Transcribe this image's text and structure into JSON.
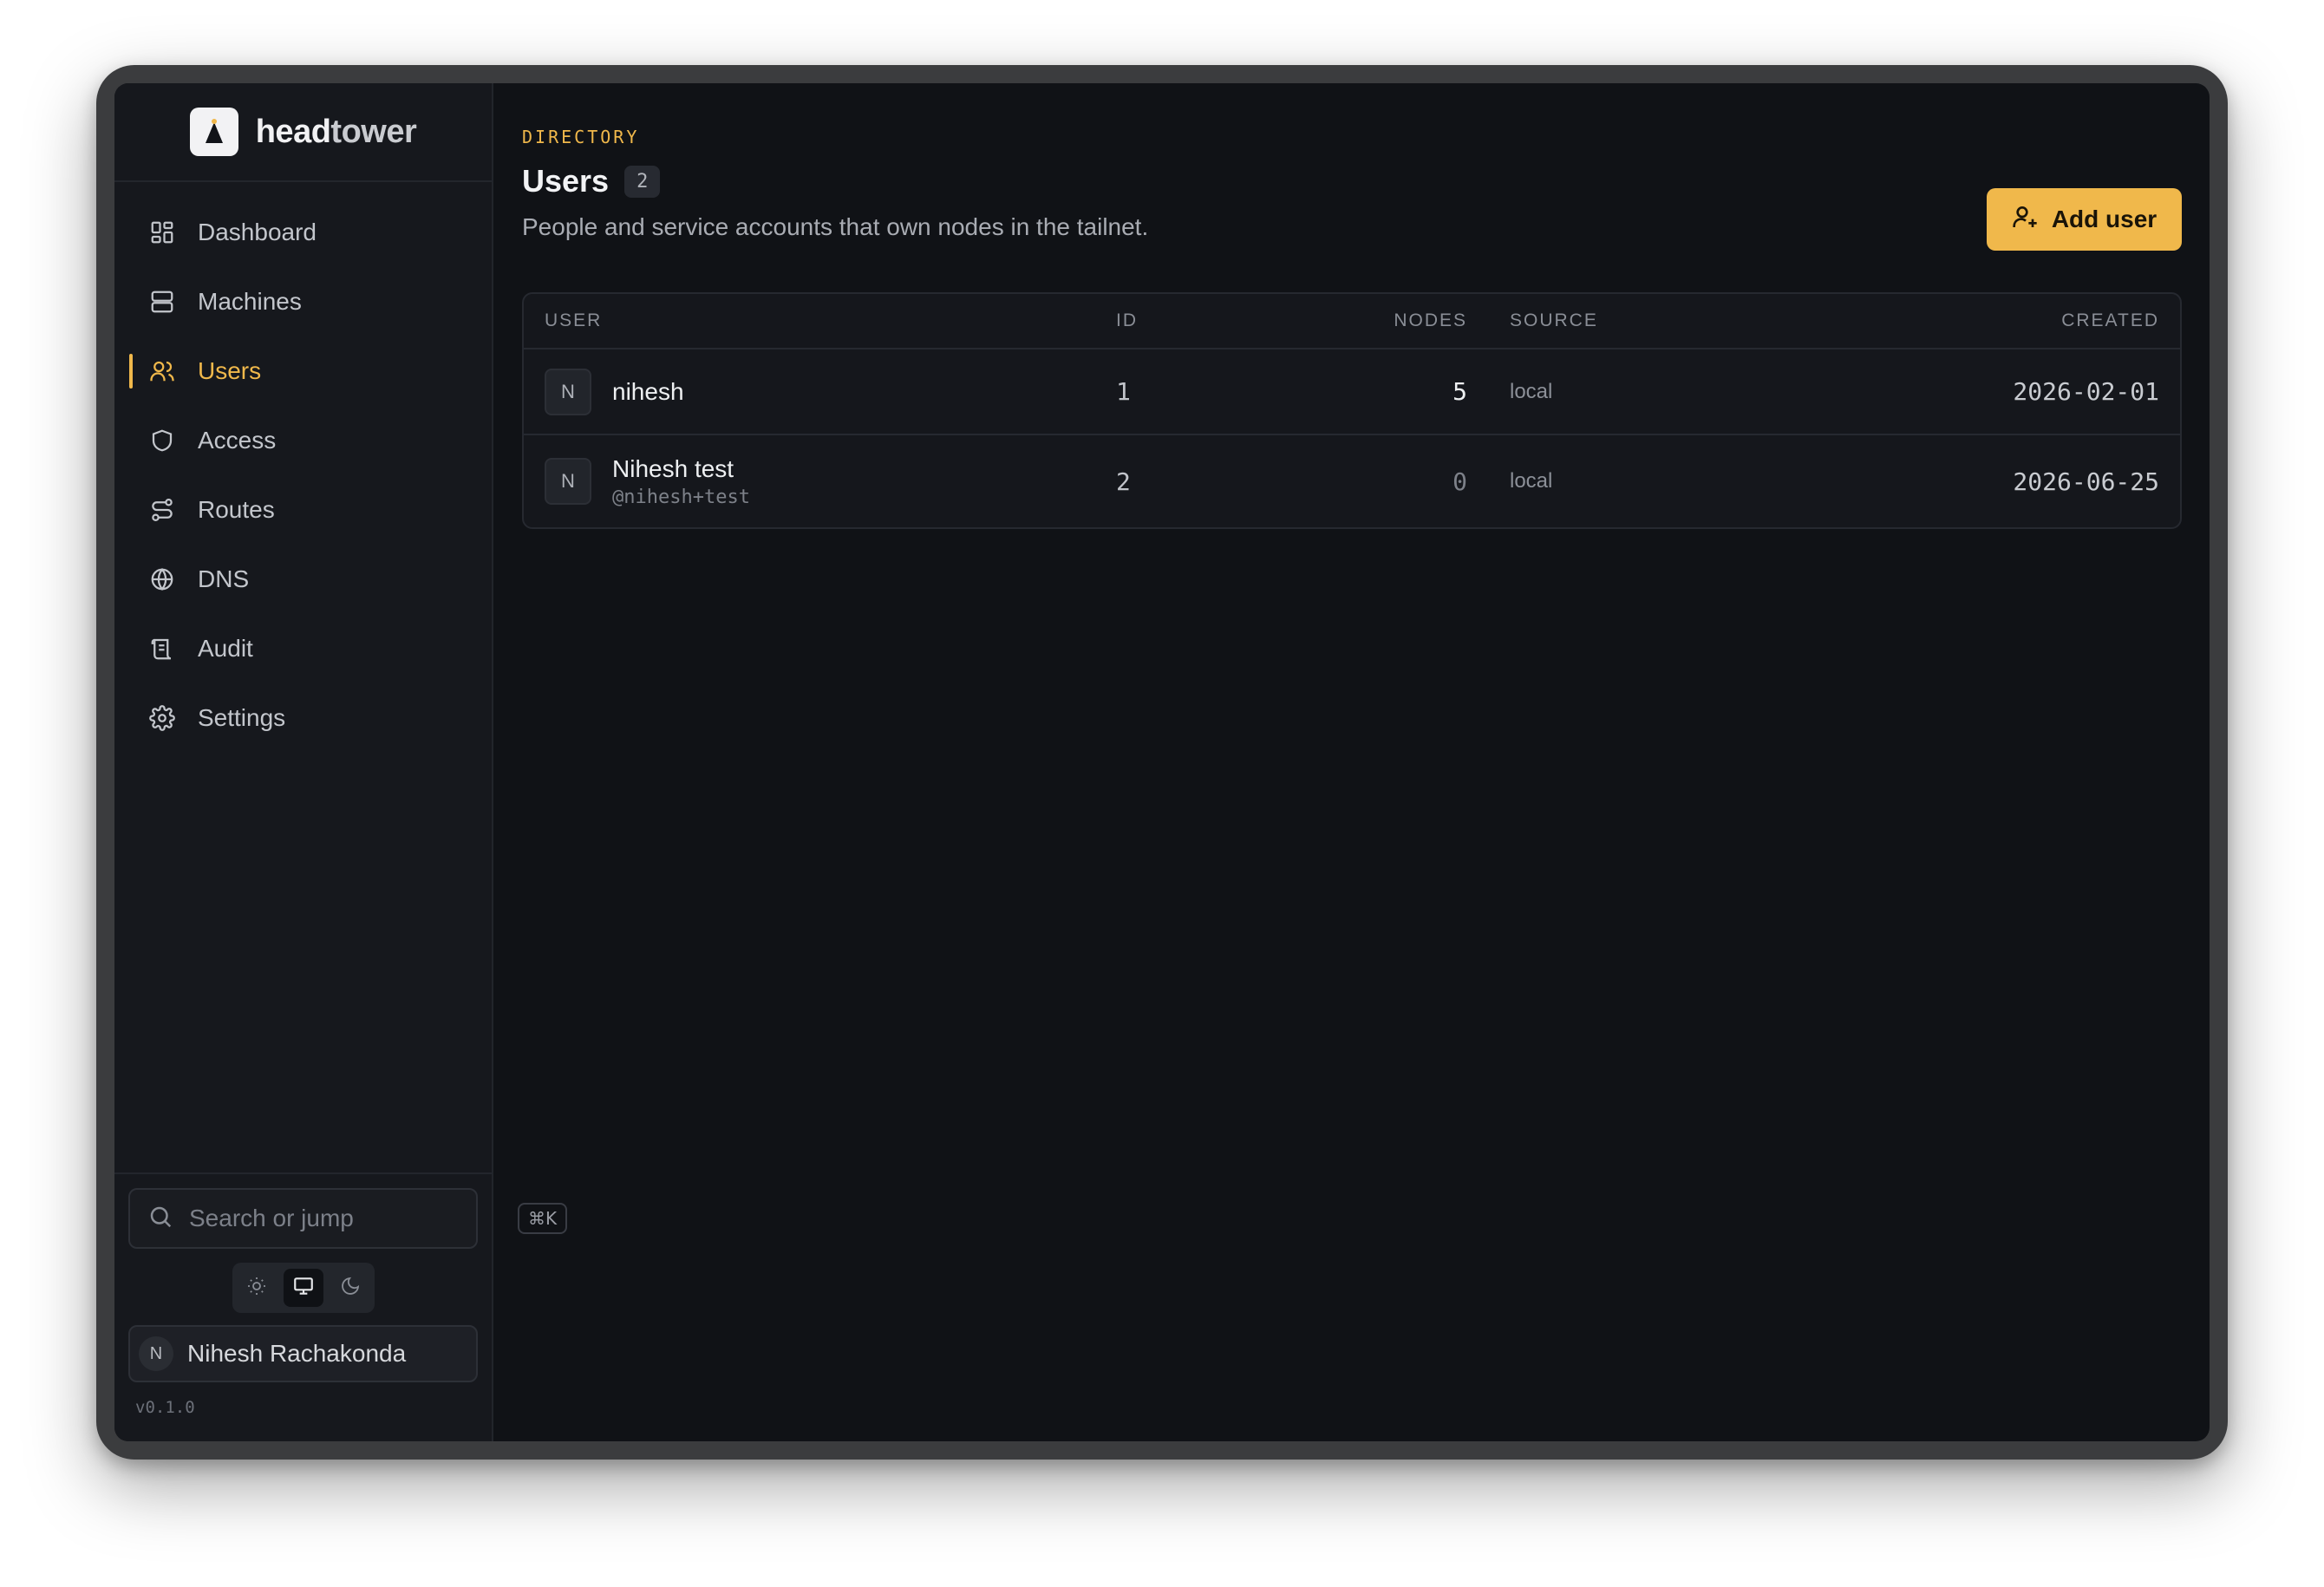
{
  "brand": {
    "name_a": "head",
    "name_b": "tower"
  },
  "sidebar": {
    "items": [
      {
        "label": "Dashboard",
        "icon": "dashboard-icon",
        "active": false
      },
      {
        "label": "Machines",
        "icon": "server-icon",
        "active": false
      },
      {
        "label": "Users",
        "icon": "users-icon",
        "active": true
      },
      {
        "label": "Access",
        "icon": "shield-icon",
        "active": false
      },
      {
        "label": "Routes",
        "icon": "route-icon",
        "active": false
      },
      {
        "label": "DNS",
        "icon": "globe-icon",
        "active": false
      },
      {
        "label": "Audit",
        "icon": "scroll-icon",
        "active": false
      },
      {
        "label": "Settings",
        "icon": "gear-icon",
        "active": false
      }
    ],
    "search": {
      "placeholder": "Search or jump",
      "shortcut": "⌘K"
    },
    "theme": {
      "options": [
        "light",
        "system",
        "dark"
      ],
      "selected": "system"
    },
    "user": {
      "avatar_initial": "N",
      "name": "Nihesh Rachakonda"
    },
    "version": "v0.1.0"
  },
  "page": {
    "eyebrow": "DIRECTORY",
    "title": "Users",
    "count": "2",
    "subtitle": "People and service accounts that own nodes in the tailnet.",
    "add_button": "Add user"
  },
  "table": {
    "headers": {
      "user": "USER",
      "id": "ID",
      "nodes": "NODES",
      "source": "SOURCE",
      "created": "CREATED"
    },
    "rows": [
      {
        "initial": "N",
        "name": "nihesh",
        "handle": "",
        "id": "1",
        "nodes": "5",
        "source": "local",
        "created": "2026-02-01"
      },
      {
        "initial": "N",
        "name": "Nihesh test",
        "handle": "@nihesh+test",
        "id": "2",
        "nodes": "0",
        "source": "local",
        "created": "2026-06-25"
      }
    ]
  },
  "colors": {
    "accent": "#f0b84b",
    "background": "#101216",
    "sidebar": "#16181d"
  }
}
